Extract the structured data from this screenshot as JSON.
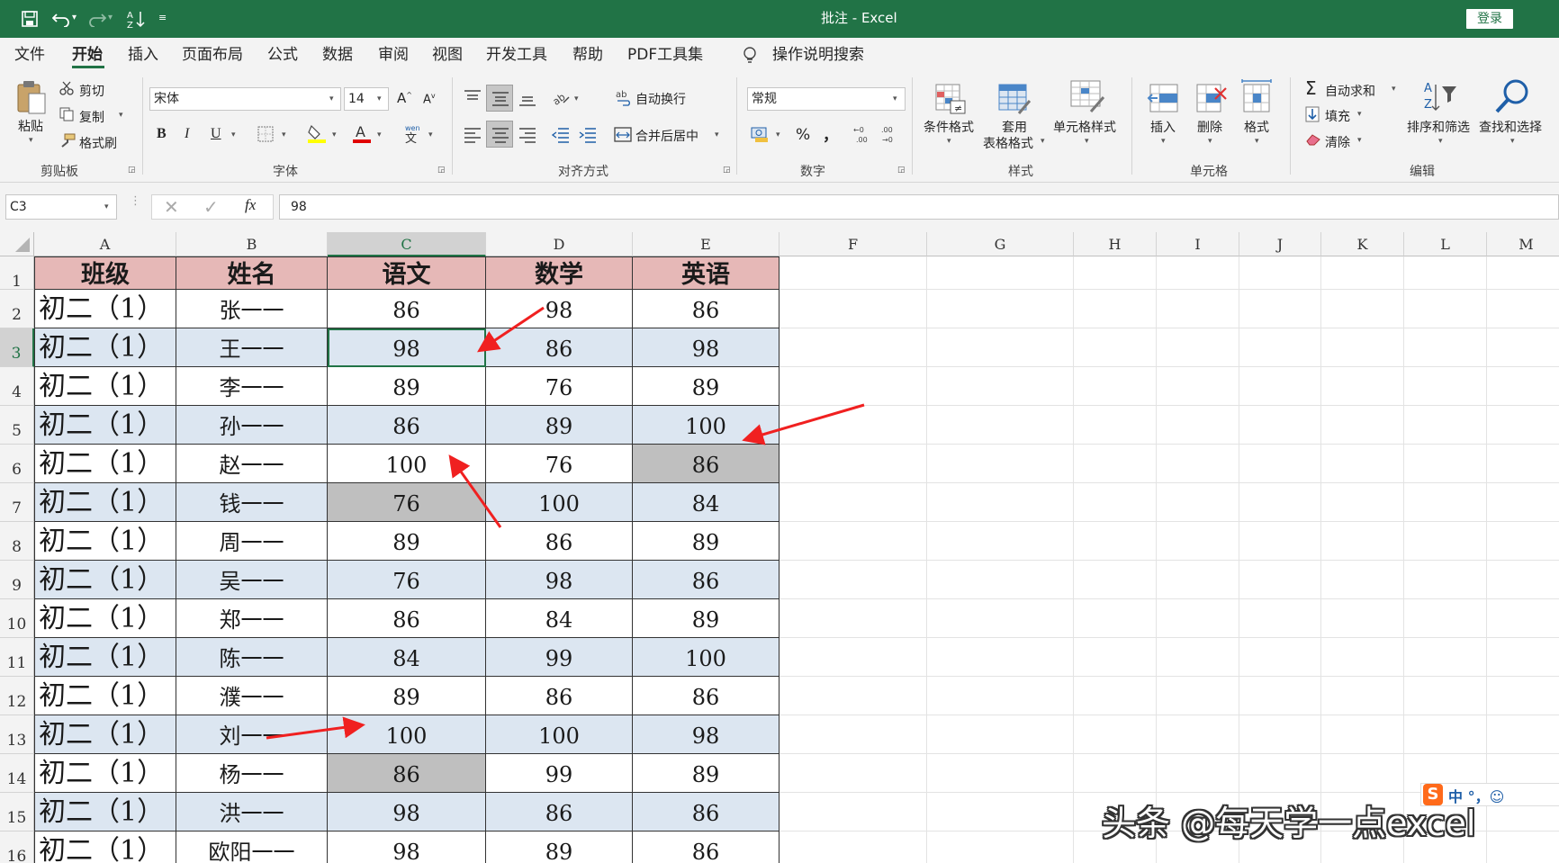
{
  "titlebar": {
    "title": "批注 - Excel",
    "login": "登录",
    "bg_color": "#217346"
  },
  "menu": {
    "items": [
      "文件",
      "开始",
      "插入",
      "页面布局",
      "公式",
      "数据",
      "审阅",
      "视图",
      "开发工具",
      "帮助",
      "PDF工具集"
    ],
    "active": "开始",
    "search": "操作说明搜索"
  },
  "ribbon": {
    "clipboard": {
      "paste": "粘贴",
      "cut": "剪切",
      "copy": "复制",
      "format_painter": "格式刷",
      "group": "剪贴板"
    },
    "font": {
      "name": "宋体",
      "size": "14",
      "group": "字体"
    },
    "alignment": {
      "wrap": "自动换行",
      "merge": "合并后居中",
      "group": "对齐方式"
    },
    "number": {
      "format": "常规",
      "percent": "%",
      "comma": "，",
      "group": "数字"
    },
    "styles": {
      "conditional": "条件格式",
      "table_line1": "套用",
      "table_line2": "表格格式",
      "cell_styles": "单元格样式",
      "group": "样式"
    },
    "cells": {
      "insert": "插入",
      "delete": "删除",
      "format": "格式",
      "group": "单元格"
    },
    "editing": {
      "autosum": "自动求和",
      "fill": "填充",
      "clear": "清除",
      "sort": "排序和筛选",
      "find": "查找和选择",
      "group": "编辑"
    }
  },
  "formula_bar": {
    "name_box": "C3",
    "fx": "fx",
    "value": "98"
  },
  "sheet": {
    "columns": [
      "A",
      "B",
      "C",
      "D",
      "E",
      "F",
      "G",
      "H",
      "I",
      "J",
      "K",
      "L",
      "M"
    ],
    "selected_column": "C",
    "row_numbers": [
      "1",
      "2",
      "3",
      "4",
      "5",
      "6",
      "7",
      "8",
      "9",
      "10",
      "11",
      "12",
      "13",
      "14",
      "15",
      "16"
    ],
    "selected_row": "3",
    "header": [
      "班级",
      "姓名",
      "语文",
      "数学",
      "英语"
    ],
    "rows": [
      [
        "初二（1）",
        "张一一",
        "86",
        "98",
        "86"
      ],
      [
        "初二（1）",
        "王一一",
        "98",
        "86",
        "98"
      ],
      [
        "初二（1）",
        "李一一",
        "89",
        "76",
        "89"
      ],
      [
        "初二（1）",
        "孙一一",
        "86",
        "89",
        "100"
      ],
      [
        "初二（1）",
        "赵一一",
        "100",
        "76",
        "86"
      ],
      [
        "初二（1）",
        "钱一一",
        "76",
        "100",
        "84"
      ],
      [
        "初二（1）",
        "周一一",
        "89",
        "86",
        "89"
      ],
      [
        "初二（1）",
        "吴一一",
        "76",
        "98",
        "86"
      ],
      [
        "初二（1）",
        "郑一一",
        "86",
        "84",
        "89"
      ],
      [
        "初二（1）",
        "陈一一",
        "84",
        "99",
        "100"
      ],
      [
        "初二（1）",
        "濮一一",
        "89",
        "86",
        "86"
      ],
      [
        "初二（1）",
        "刘一一",
        "100",
        "100",
        "98"
      ],
      [
        "初二（1）",
        "杨一一",
        "86",
        "99",
        "89"
      ],
      [
        "初二（1）",
        "洪一一",
        "98",
        "86",
        "86"
      ],
      [
        "初二（1）",
        "欧阳一一",
        "98",
        "89",
        "86"
      ]
    ],
    "header_fill": "#e6b8b7",
    "band_fill": "#dce6f1",
    "highlight_fill": "#bfbfbf"
  },
  "watermark": "头条 @每天学一点excel",
  "ime_status": "中 °，☺"
}
